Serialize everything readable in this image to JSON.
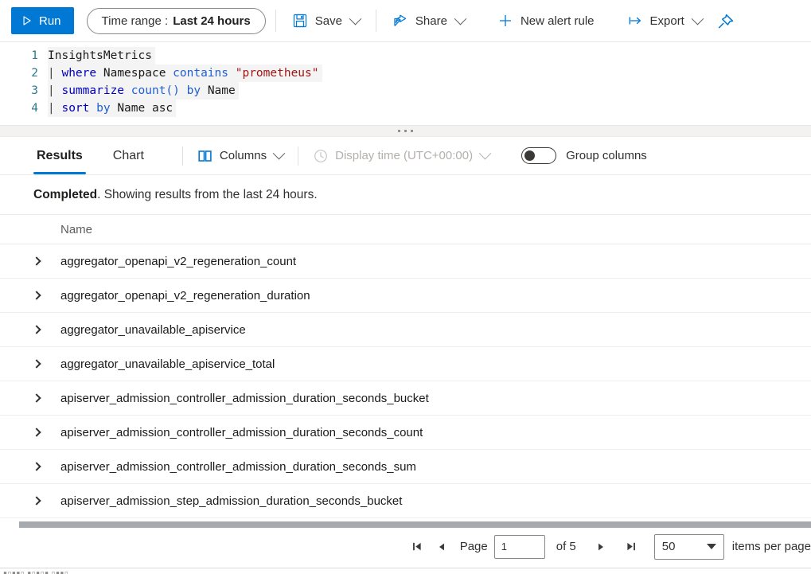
{
  "commandbar": {
    "run_label": "Run",
    "run_icon": "play-icon",
    "timerange_label": "Time range :",
    "timerange_value": "Last 24 hours",
    "save_label": "Save",
    "save_icon": "save-floppy-icon",
    "share_label": "Share",
    "share_icon": "share-icon",
    "new_alert_label": "New alert rule",
    "new_alert_icon": "plus-icon",
    "export_label": "Export",
    "export_icon": "export-arrow-icon",
    "pin_icon": "pin-icon",
    "accent_color": "#0078d4"
  },
  "editor": {
    "lines": [
      {
        "num": "1",
        "tokens": [
          {
            "t": "InsightsMetrics",
            "c": "k-tbl"
          }
        ]
      },
      {
        "num": "2",
        "tokens": [
          {
            "t": "| ",
            "c": "k-pipe"
          },
          {
            "t": "where",
            "c": "k-op"
          },
          {
            "t": " Namespace ",
            "c": "k-id"
          },
          {
            "t": "contains",
            "c": "k-kw"
          },
          {
            "t": " ",
            "c": "k-id"
          },
          {
            "t": "\"prometheus\"",
            "c": "k-str"
          }
        ]
      },
      {
        "num": "3",
        "tokens": [
          {
            "t": "| ",
            "c": "k-pipe"
          },
          {
            "t": "summarize",
            "c": "k-op"
          },
          {
            "t": " ",
            "c": "k-id"
          },
          {
            "t": "count()",
            "c": "k-kw"
          },
          {
            "t": " ",
            "c": "k-id"
          },
          {
            "t": "by",
            "c": "k-kw"
          },
          {
            "t": " Name",
            "c": "k-id"
          }
        ]
      },
      {
        "num": "4",
        "tokens": [
          {
            "t": "| ",
            "c": "k-pipe"
          },
          {
            "t": "sort",
            "c": "k-op"
          },
          {
            "t": " ",
            "c": "k-id"
          },
          {
            "t": "by",
            "c": "k-kw"
          },
          {
            "t": " Name asc",
            "c": "k-id"
          }
        ]
      }
    ]
  },
  "results_toolbar": {
    "tabs": [
      {
        "label": "Results",
        "active": true
      },
      {
        "label": "Chart",
        "active": false
      }
    ],
    "columns_label": "Columns",
    "columns_icon": "columns-icon",
    "display_time_label": "Display time (UTC+00:00)",
    "display_time_icon": "clock-icon",
    "display_time_disabled": true,
    "group_columns_label": "Group columns",
    "group_columns_on": false
  },
  "status": {
    "state": "Completed",
    "message": ". Showing results from the last 24 hours."
  },
  "table": {
    "columns": [
      "Name"
    ],
    "expand_icon": "chevron-right-icon",
    "rows": [
      {
        "name": "aggregator_openapi_v2_regeneration_count"
      },
      {
        "name": "aggregator_openapi_v2_regeneration_duration"
      },
      {
        "name": "aggregator_unavailable_apiservice"
      },
      {
        "name": "aggregator_unavailable_apiservice_total"
      },
      {
        "name": "apiserver_admission_controller_admission_duration_seconds_bucket"
      },
      {
        "name": "apiserver_admission_controller_admission_duration_seconds_count"
      },
      {
        "name": "apiserver_admission_controller_admission_duration_seconds_sum"
      },
      {
        "name": "apiserver_admission_step_admission_duration_seconds_bucket"
      }
    ]
  },
  "pager": {
    "first_icon": "first-page-icon",
    "prev_icon": "prev-page-icon",
    "page_label": "Page",
    "page_value": "1",
    "of_label": "of 5",
    "next_icon": "next-page-icon",
    "last_icon": "last-page-icon",
    "page_size": "50",
    "items_per_page_label": "items per page"
  }
}
